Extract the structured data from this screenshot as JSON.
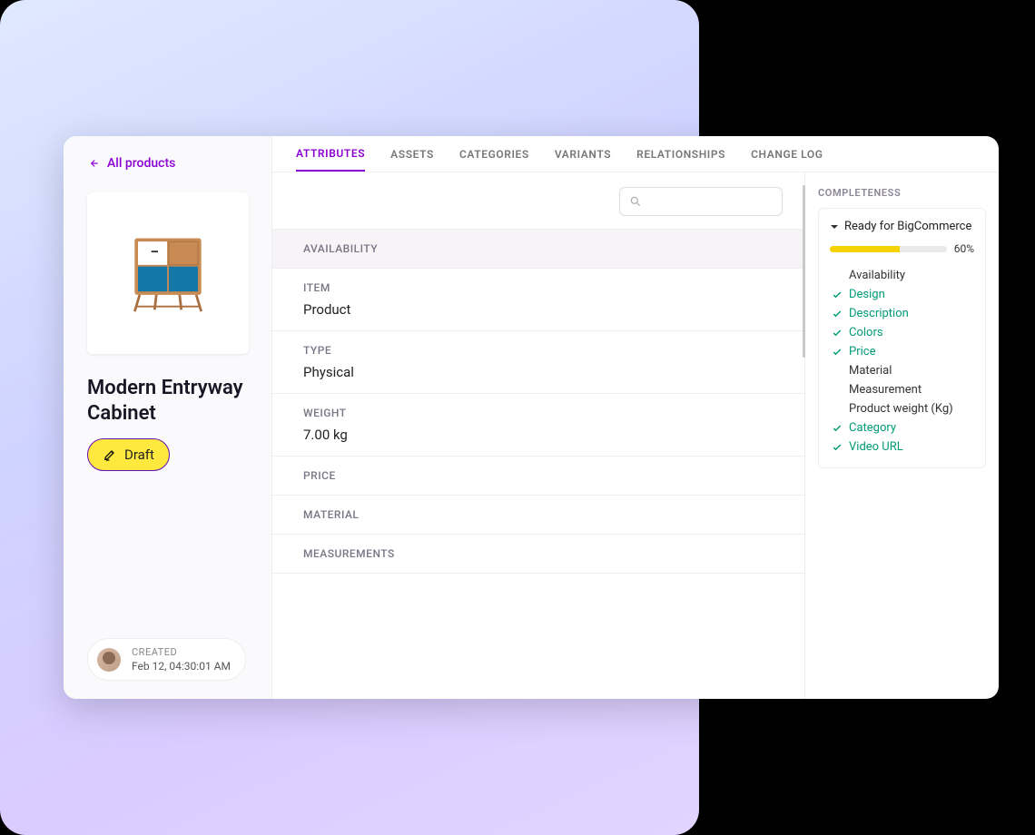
{
  "nav": {
    "back_label": "All products"
  },
  "product": {
    "title": "Modern Entryway Cabinet",
    "status_label": "Draft"
  },
  "meta": {
    "created_label": "CREATED",
    "created_ts": "Feb 12, 04:30:01 AM"
  },
  "tabs": [
    {
      "label": "ATTRIBUTES",
      "active": true
    },
    {
      "label": "ASSETS"
    },
    {
      "label": "CATEGORIES"
    },
    {
      "label": "VARIANTS"
    },
    {
      "label": "RELATIONSHIPS"
    },
    {
      "label": "CHANGE LOG"
    }
  ],
  "attributes": {
    "availability_header": "AVAILABILITY",
    "item": {
      "label": "ITEM",
      "value": "Product"
    },
    "type": {
      "label": "TYPE",
      "value": "Physical"
    },
    "weight": {
      "label": "WEIGHT",
      "value": "7.00 kg"
    },
    "price_header": "PRICE",
    "material_header": "MATERIAL",
    "measurements_header": "MEASUREMENTS"
  },
  "completeness": {
    "title": "COMPLETENESS",
    "group_label": "Ready for BigCommerce",
    "percent_label": "60%",
    "percent_value": 60,
    "items": [
      {
        "label": "Availability",
        "done": false
      },
      {
        "label": "Design",
        "done": true
      },
      {
        "label": "Description",
        "done": true
      },
      {
        "label": "Colors",
        "done": true
      },
      {
        "label": "Price",
        "done": true
      },
      {
        "label": "Material",
        "done": false
      },
      {
        "label": "Measurement",
        "done": false
      },
      {
        "label": "Product weight (Kg)",
        "done": false
      },
      {
        "label": "Category",
        "done": true
      },
      {
        "label": "Video URL",
        "done": true
      }
    ]
  }
}
